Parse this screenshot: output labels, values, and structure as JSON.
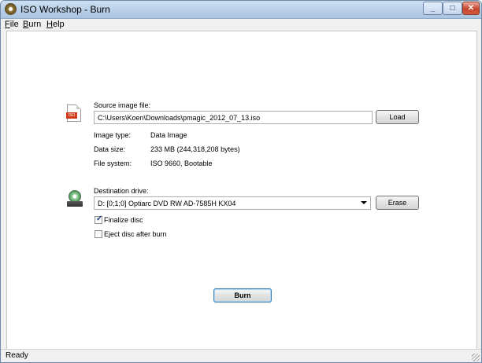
{
  "window": {
    "title": "ISO Workshop - Burn"
  },
  "menu": [
    {
      "label": "File",
      "accel": "F",
      "rest": "ile"
    },
    {
      "label": "Burn",
      "accel": "B",
      "rest": "urn"
    },
    {
      "label": "Help",
      "accel": "H",
      "rest": "elp"
    }
  ],
  "source": {
    "label": "Source image file:",
    "path": "C:\\Users\\Koen\\Downloads\\pmagic_2012_07_13.iso",
    "load_label": "Load",
    "icon_text": "ISO"
  },
  "info": {
    "image_type_label": "Image type:",
    "image_type_value": "Data Image",
    "data_size_label": "Data size:",
    "data_size_value": "233 MB (244,318,208 bytes)",
    "file_system_label": "File system:",
    "file_system_value": "ISO 9660, Bootable"
  },
  "destination": {
    "label": "Destination drive:",
    "selected": "D:  [0;1;0] Optiarc  DVD RW AD-7585H  KX04",
    "erase_label": "Erase"
  },
  "options": {
    "finalize_label": "Finalize disc",
    "finalize_checked": true,
    "eject_label": "Eject disc after burn",
    "eject_checked": false
  },
  "burn_label": "Burn",
  "status": "Ready"
}
